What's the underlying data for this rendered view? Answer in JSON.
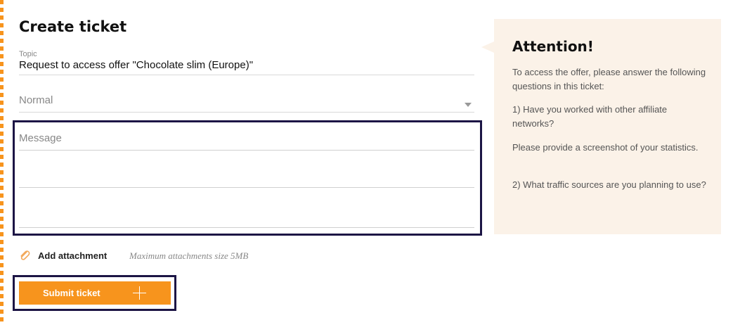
{
  "form": {
    "title": "Create ticket",
    "topic_label": "Topic",
    "topic_value": "Request to access offer \"Chocolate slim (Europe)\"",
    "priority_value": "Normal",
    "message_placeholder": "Message",
    "attach_label": "Add attachment",
    "attach_note": "Maximum attachments size 5MB",
    "submit_label": "Submit ticket"
  },
  "attention": {
    "title": "Attention!",
    "paragraphs": [
      "To access the offer, please answer the following questions in this ticket:",
      "1) Have you worked with other affiliate networks?",
      "Please provide a screenshot of your statistics.",
      "2) What traffic sources are you planning to use?"
    ]
  },
  "colors": {
    "accent": "#f7941d",
    "focus_border": "#1c1545",
    "attention_bg": "#fbf2e8"
  },
  "icons": {
    "attachment": "paperclip-icon",
    "submit": "plus-icon",
    "priority": "chevron-down-icon"
  }
}
